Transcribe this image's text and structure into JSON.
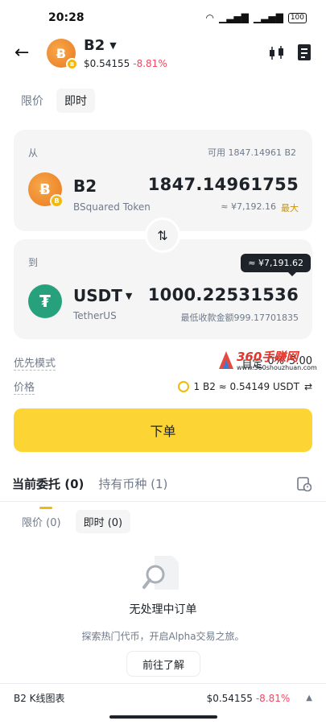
{
  "status": {
    "time": "20:28",
    "battery": "100"
  },
  "header": {
    "token": "B2",
    "price": "$0.54155",
    "change": "-8.81%"
  },
  "mode_tabs": [
    "限价",
    "即时"
  ],
  "from_card": {
    "label": "从",
    "available": "可用 1847.14961 B2",
    "symbol": "B2",
    "name": "BSquared Token",
    "amount": "1847.14961755",
    "fiat": "≈ ¥7,192.16",
    "max_label": "最大"
  },
  "to_card": {
    "label": "到",
    "symbol": "USDT",
    "name": "TetherUS",
    "amount": "1000.22531536",
    "min_receive": "最低收款金额999.17701835",
    "tooltip": "≈ ¥7,191.62"
  },
  "priority": {
    "label": "优先模式",
    "value": "自定",
    "extra": "0%",
    "extra2": "5.00"
  },
  "price_row": {
    "label": "价格",
    "value": "1 B2 ≈ 0.54149 USDT",
    "icon": "swap-arrows-icon"
  },
  "order_button": "下单",
  "section_tabs": [
    "当前委托 (0)",
    "持有币种 (1)"
  ],
  "sub_tabs": [
    "限价 (0)",
    "即时 (0)"
  ],
  "empty": {
    "title": "无处理中订单",
    "subtitle": "探索热门代币，开启Alpha交易之旅。",
    "button": "前往了解"
  },
  "bottom_bar": {
    "label": "B2 K线图表",
    "price": "$0.54155",
    "change": "-8.81%"
  },
  "watermark": {
    "main": "360手赚网",
    "sub": "www.360shouzhuan.com"
  },
  "colors": {
    "accent": "#fcd535",
    "negative": "#f6465d",
    "usdt": "#26a17b",
    "b2": "#e8791f"
  }
}
